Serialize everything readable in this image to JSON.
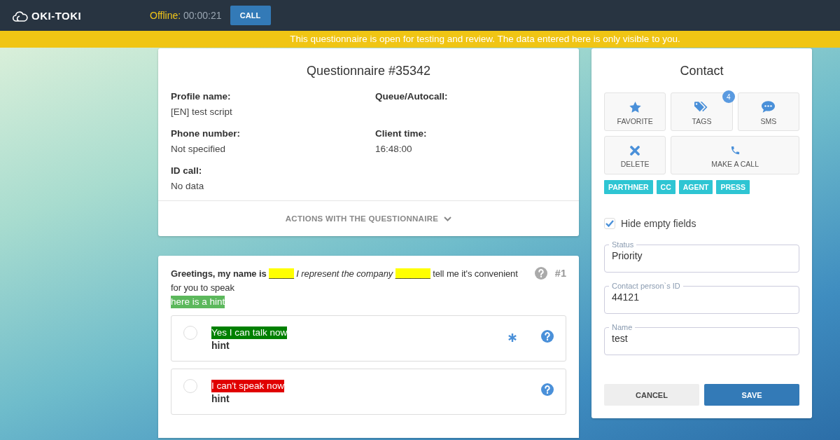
{
  "app": {
    "name": "OKI-TOKI"
  },
  "topbar": {
    "status_label": "Offline:",
    "timer": "00:00:21",
    "call_button": "CALL"
  },
  "banner": "This questionnaire is open for testing and review. The data entered here is only visible to you.",
  "questionnaire": {
    "title": "Questionnaire #35342",
    "fields": [
      {
        "label": "Profile name:",
        "value": "[EN] test script"
      },
      {
        "label": "Queue/Autocall:"
      },
      {
        "label": "Phone number:",
        "value": "Not specified"
      },
      {
        "label": "Client time:",
        "value": "16:48:00"
      },
      {
        "label": "ID call:",
        "value": "No data"
      }
    ],
    "actions": "ACTIONS WITH THE QUESTIONNAIRE"
  },
  "question": {
    "parts": [
      {
        "kind": "bold",
        "text": "Greetings, my name is"
      },
      {
        "kind": "blank",
        "text": "_____"
      },
      {
        "kind": "italic",
        "text": "I represent the company"
      },
      {
        "kind": "blank",
        "text": "_______"
      },
      {
        "kind": "plain",
        "text": "tell me it's convenient for you to speak"
      }
    ],
    "number": "#1",
    "hint": "here is a hint",
    "answers": [
      {
        "label": "Yes I can talk now",
        "color": "#008000",
        "hint": "hint",
        "required": true,
        "selected": false
      },
      {
        "label": "I can't speak now",
        "color": "#e00000",
        "hint": "hint",
        "required": false,
        "selected": false
      }
    ]
  },
  "contact": {
    "title": "Contact",
    "actions": [
      {
        "kind": "favorite",
        "label": "FAVORITE"
      },
      {
        "kind": "tags",
        "label": "TAGS",
        "badge": "4"
      },
      {
        "kind": "sms",
        "label": "SMS"
      },
      {
        "kind": "delete",
        "label": "DELETE"
      },
      {
        "kind": "call",
        "label": "MAKE A CALL"
      }
    ],
    "tags": [
      "PARTHNER",
      "CC",
      "AGENT",
      "PRESS"
    ],
    "hide_empty": {
      "label": "Hide empty fields",
      "checked": true
    },
    "fields": [
      {
        "label": "Status",
        "value": "Priority"
      },
      {
        "label": "Contact person`s ID",
        "value": "44121"
      },
      {
        "label": "Name",
        "value": "test"
      }
    ],
    "buttons": [
      {
        "kind": "cancel",
        "label": "CANCEL"
      },
      {
        "kind": "save",
        "label": "SAVE"
      }
    ]
  }
}
